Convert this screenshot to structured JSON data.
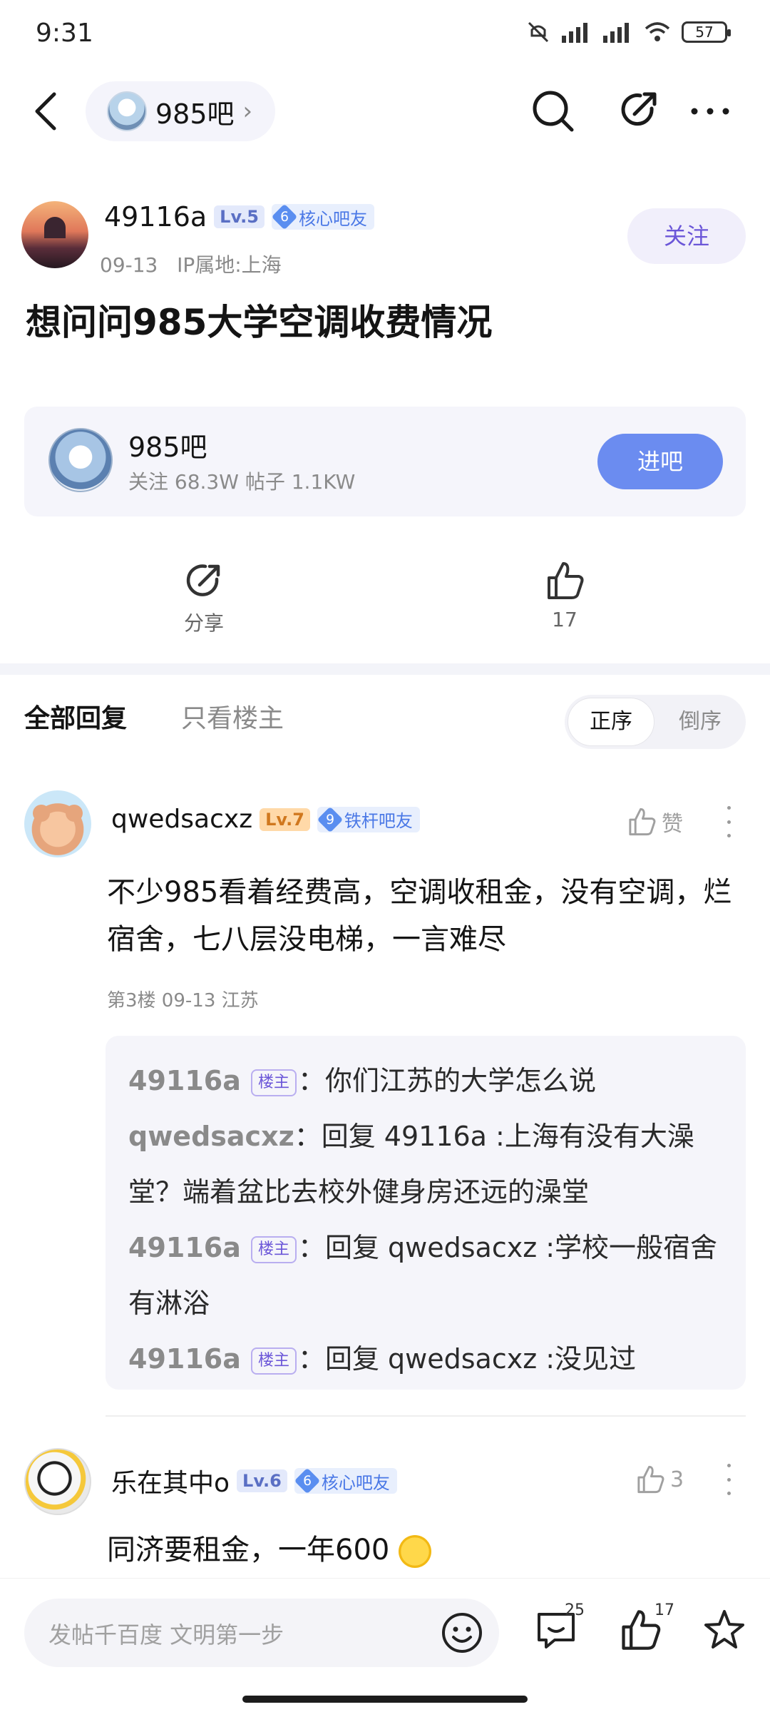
{
  "status_bar": {
    "time": "9:31",
    "battery": "57"
  },
  "nav": {
    "forum_name": "985吧",
    "chevron": "›"
  },
  "post": {
    "author": "49116a",
    "level": "Lv.5",
    "badge_num": "6",
    "badge_label": "核心吧友",
    "date": "09-13",
    "ip": "IP属地:上海",
    "follow_label": "关注",
    "title": "想问问985大学空调收费情况"
  },
  "forum_card": {
    "name": "985吧",
    "stats": "关注 68.3W  帖子 1.1KW",
    "enter_label": "进吧"
  },
  "actions": {
    "share_label": "分享",
    "like_count": "17"
  },
  "tabs": {
    "all_label": "全部回复",
    "op_only_label": "只看楼主",
    "asc_label": "正序",
    "desc_label": "倒序"
  },
  "comments": [
    {
      "user": "qwedsacxz",
      "level": "Lv.7",
      "badge_num": "9",
      "badge_label": "铁杆吧友",
      "like_label": "赞",
      "text": "不少985看着经费高，空调收租金，没有空调，烂宿舍，七八层没电梯，一言难尽",
      "meta": "第3楼  09-13  江苏",
      "replies": [
        {
          "name": "49116a",
          "op": true,
          "text": "：你们江苏的大学怎么说"
        },
        {
          "name": "qwedsacxz",
          "op": false,
          "text": "：回复 49116a :上海有没有大澡堂？端着盆比去校外健身房还远的澡堂"
        },
        {
          "name": "49116a",
          "op": true,
          "text": "：回复 qwedsacxz :学校一般宿舍有淋浴"
        },
        {
          "name": "49116a",
          "op": true,
          "text": "：回复 qwedsacxz :没见过"
        }
      ]
    },
    {
      "user": "乐在其中o",
      "level": "Lv.6",
      "badge_num": "6",
      "badge_label": "核心吧友",
      "like_count": "3",
      "text": "同济要租金，一年600"
    }
  ],
  "op_tag": "楼主",
  "bottom": {
    "placeholder": "发帖千百度 文明第一步",
    "comment_count": "25",
    "like_count": "17"
  },
  "colors": {
    "accent": "#6b56d8",
    "enter_button": "#6b8cf0",
    "badge": "#5a8ef0"
  }
}
